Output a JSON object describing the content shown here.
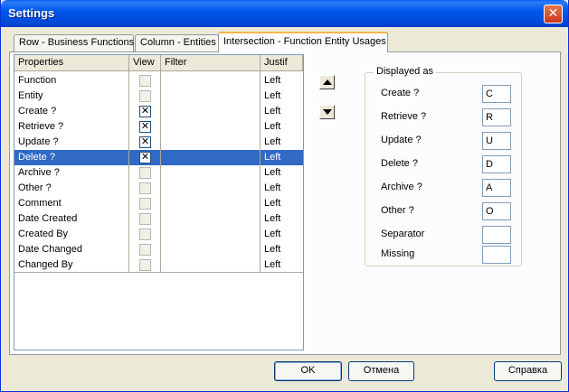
{
  "window": {
    "title": "Settings",
    "close_glyph": "✕"
  },
  "tabs": [
    {
      "label": "Row - Business Functions",
      "active": false
    },
    {
      "label": "Column - Entities",
      "active": false
    },
    {
      "label": "Intersection - Function Entity Usages",
      "active": true
    }
  ],
  "grid": {
    "columns": [
      "Properties",
      "View",
      "Filter",
      "Justif"
    ],
    "rows": [
      {
        "property": "Function",
        "view": false,
        "justif": "Left"
      },
      {
        "property": "Entity",
        "view": false,
        "justif": "Left"
      },
      {
        "property": "Create ?",
        "view": true,
        "justif": "Left"
      },
      {
        "property": "Retrieve ?",
        "view": true,
        "justif": "Left"
      },
      {
        "property": "Update ?",
        "view": true,
        "justif": "Left"
      },
      {
        "property": "Delete ?",
        "view": true,
        "justif": "Left",
        "selected": true
      },
      {
        "property": "Archive ?",
        "view": false,
        "justif": "Left"
      },
      {
        "property": "Other ?",
        "view": false,
        "justif": "Left"
      },
      {
        "property": "Comment",
        "view": false,
        "justif": "Left"
      },
      {
        "property": "Date Created",
        "view": false,
        "justif": "Left"
      },
      {
        "property": "Created By",
        "view": false,
        "justif": "Left"
      },
      {
        "property": "Date Changed",
        "view": false,
        "justif": "Left"
      },
      {
        "property": "Changed By",
        "view": false,
        "justif": "Left"
      }
    ],
    "check_glyph": "✕"
  },
  "displayed_as": {
    "legend": "Displayed as",
    "fields": [
      {
        "label": "Create ?",
        "value": "C"
      },
      {
        "label": "Retrieve ?",
        "value": "R"
      },
      {
        "label": "Update ?",
        "value": "U"
      },
      {
        "label": "Delete ?",
        "value": "D"
      },
      {
        "label": "Archive ?",
        "value": "A"
      },
      {
        "label": "Other ?",
        "value": "O"
      },
      {
        "label": "Separator",
        "value": ""
      },
      {
        "label": "Missing",
        "value": ""
      }
    ]
  },
  "buttons": {
    "ok": "OK",
    "cancel": "Отмена",
    "help": "Справка"
  },
  "icons": {
    "move_up": "up-arrow-icon",
    "move_down": "down-arrow-icon"
  },
  "colors": {
    "titlebar": "#0058ee",
    "selection": "#316ac5",
    "dialog_bg": "#ece9d8"
  }
}
